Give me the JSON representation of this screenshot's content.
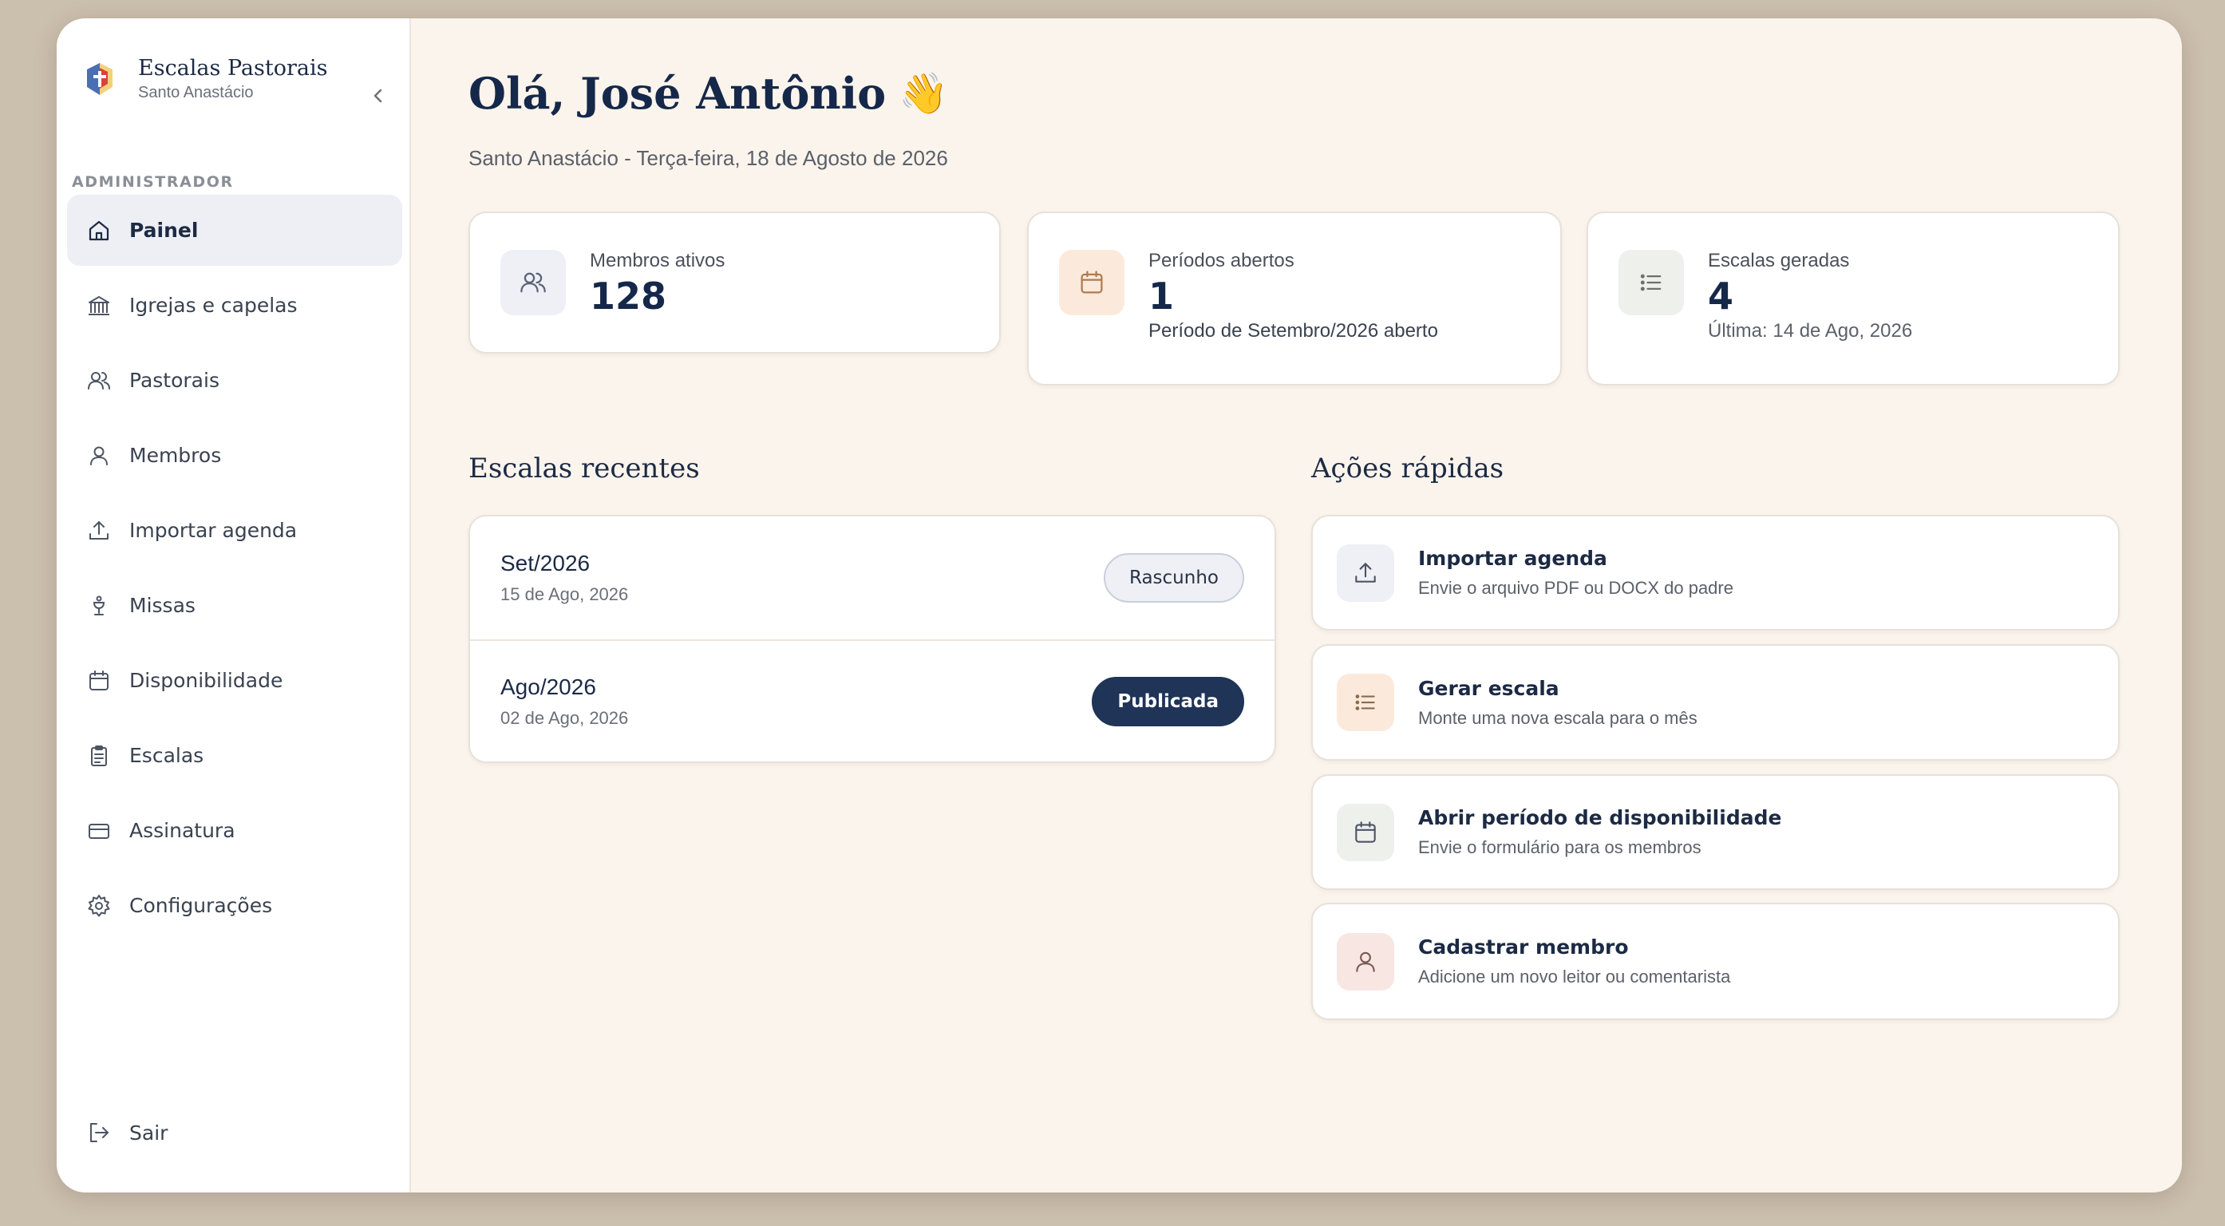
{
  "brand": {
    "title": "Escalas Pastorais",
    "subtitle": "Santo Anastácio"
  },
  "sidebar": {
    "section_label": "ADMINISTRADOR",
    "items": [
      {
        "label": "Painel",
        "icon": "home-icon",
        "active": true
      },
      {
        "label": "Igrejas e capelas",
        "icon": "church-icon"
      },
      {
        "label": "Pastorais",
        "icon": "users-icon"
      },
      {
        "label": "Membros",
        "icon": "user-icon"
      },
      {
        "label": "Importar agenda",
        "icon": "upload-icon"
      },
      {
        "label": "Missas",
        "icon": "chalice-icon"
      },
      {
        "label": "Disponibilidade",
        "icon": "calendar-icon"
      },
      {
        "label": "Escalas",
        "icon": "clipboard-icon"
      },
      {
        "label": "Assinatura",
        "icon": "credit-card-icon"
      },
      {
        "label": "Configurações",
        "icon": "gear-icon"
      }
    ],
    "logout": "Sair"
  },
  "header": {
    "greeting": "Olá, José Antônio",
    "wave": "👋",
    "subtitle": "Santo Anastácio - Terça-feira, 18 de Agosto de 2026"
  },
  "stats": [
    {
      "label": "Membros ativos",
      "value": "128",
      "icon": "users-icon"
    },
    {
      "label": "Períodos abertos",
      "value": "1",
      "note": "Período de Setembro/2026 aberto",
      "icon": "calendar-icon"
    },
    {
      "label": "Escalas geradas",
      "value": "4",
      "note": "Última: 14 de Ago, 2026",
      "icon": "list-icon"
    }
  ],
  "recent": {
    "title": "Escalas recentes",
    "items": [
      {
        "title": "Set/2026",
        "date": "15 de Ago, 2026",
        "status": "Rascunho"
      },
      {
        "title": "Ago/2026",
        "date": "02 de Ago, 2026",
        "status": "Publicada"
      }
    ]
  },
  "actions": {
    "title": "Ações rápidas",
    "items": [
      {
        "title": "Importar agenda",
        "desc": "Envie o arquivo PDF ou DOCX do padre",
        "icon": "upload-icon"
      },
      {
        "title": "Gerar escala",
        "desc": "Monte uma nova escala para o mês",
        "icon": "list-icon"
      },
      {
        "title": "Abrir período de disponibilidade",
        "desc": "Envie o formulário para os membros",
        "icon": "calendar-icon"
      },
      {
        "title": "Cadastrar membro",
        "desc": "Adicione um novo leitor ou comentarista",
        "icon": "user-icon"
      }
    ]
  },
  "colors": {
    "primary": "#1f3456",
    "background": "#fbf4ec",
    "active_nav": "#edeff5"
  }
}
